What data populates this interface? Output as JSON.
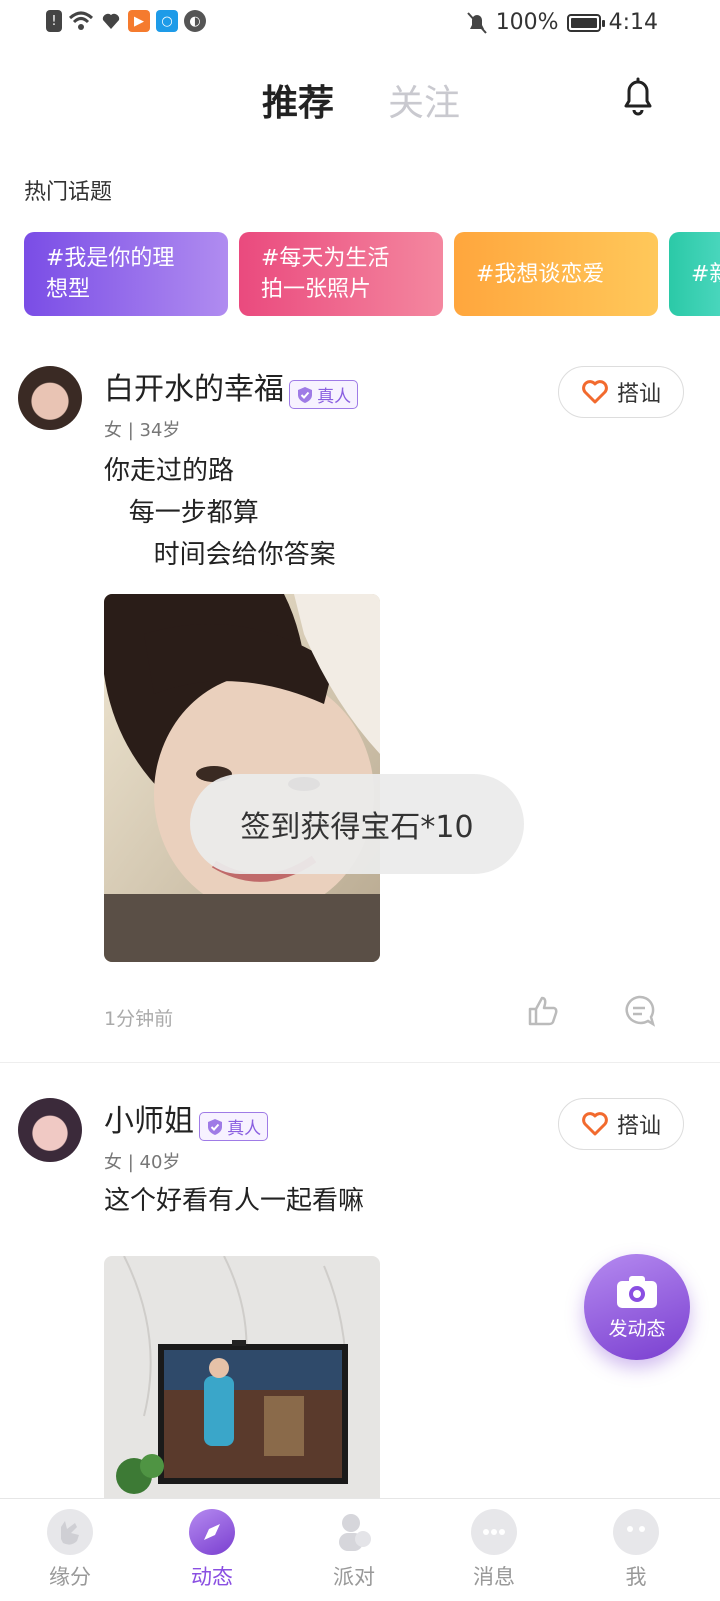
{
  "status_bar": {
    "battery": "100%",
    "time": "4:14"
  },
  "top_tabs": {
    "recommend": "推荐",
    "follow": "关注"
  },
  "hot_topics": {
    "title": "热门话题",
    "chips": [
      {
        "label": "#我是你的理\n想型"
      },
      {
        "label": "#每天为生活\n拍一张照片"
      },
      {
        "label": "#我想谈恋爱"
      },
      {
        "label": "#新"
      }
    ]
  },
  "posts": [
    {
      "username": "白开水的幸福",
      "verified_label": "真人",
      "meta": "女 | 34岁",
      "greet_label": "搭讪",
      "text": "你走过的路\n   每一步都算\n      时间会给你答案",
      "time": "1分钟前"
    },
    {
      "username": "小师姐",
      "verified_label": "真人",
      "meta": "女 | 40岁",
      "greet_label": "搭讪",
      "text": "这个好看有人一起看嘛"
    }
  ],
  "toast": "签到获得宝石*10",
  "fab_label": "发动态",
  "bottom_nav": [
    {
      "label": "缘分"
    },
    {
      "label": "动态",
      "active": true
    },
    {
      "label": "派对"
    },
    {
      "label": "消息"
    },
    {
      "label": "我"
    }
  ],
  "colors": {
    "accent": "#8a4fe2",
    "heart": "#f26a2e"
  }
}
